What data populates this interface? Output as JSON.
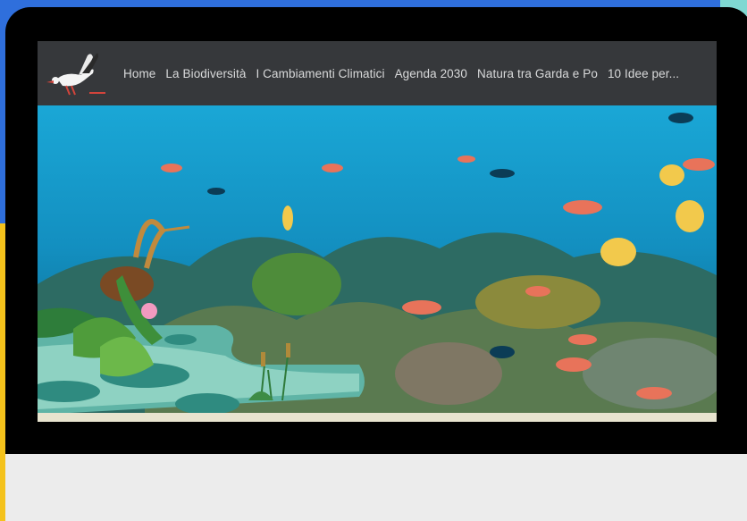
{
  "site": {
    "logo_icon": "stork-logo-icon",
    "nav_items": [
      {
        "label": "Home"
      },
      {
        "label": "La Biodiversità"
      },
      {
        "label": "I Cambiamenti Climatici"
      },
      {
        "label": "Agenda 2030"
      },
      {
        "label": "Natura tra Garda e Po"
      },
      {
        "label": "10 Idee per..."
      }
    ]
  },
  "hero": {
    "image_icon": "coral-reef-image",
    "illustration_icon": "heron-pond-illustration"
  },
  "colors": {
    "page_background": "#2f6fdc",
    "navbar": "#36383b",
    "nav_text": "#d9dadb",
    "frame": "#000000"
  }
}
